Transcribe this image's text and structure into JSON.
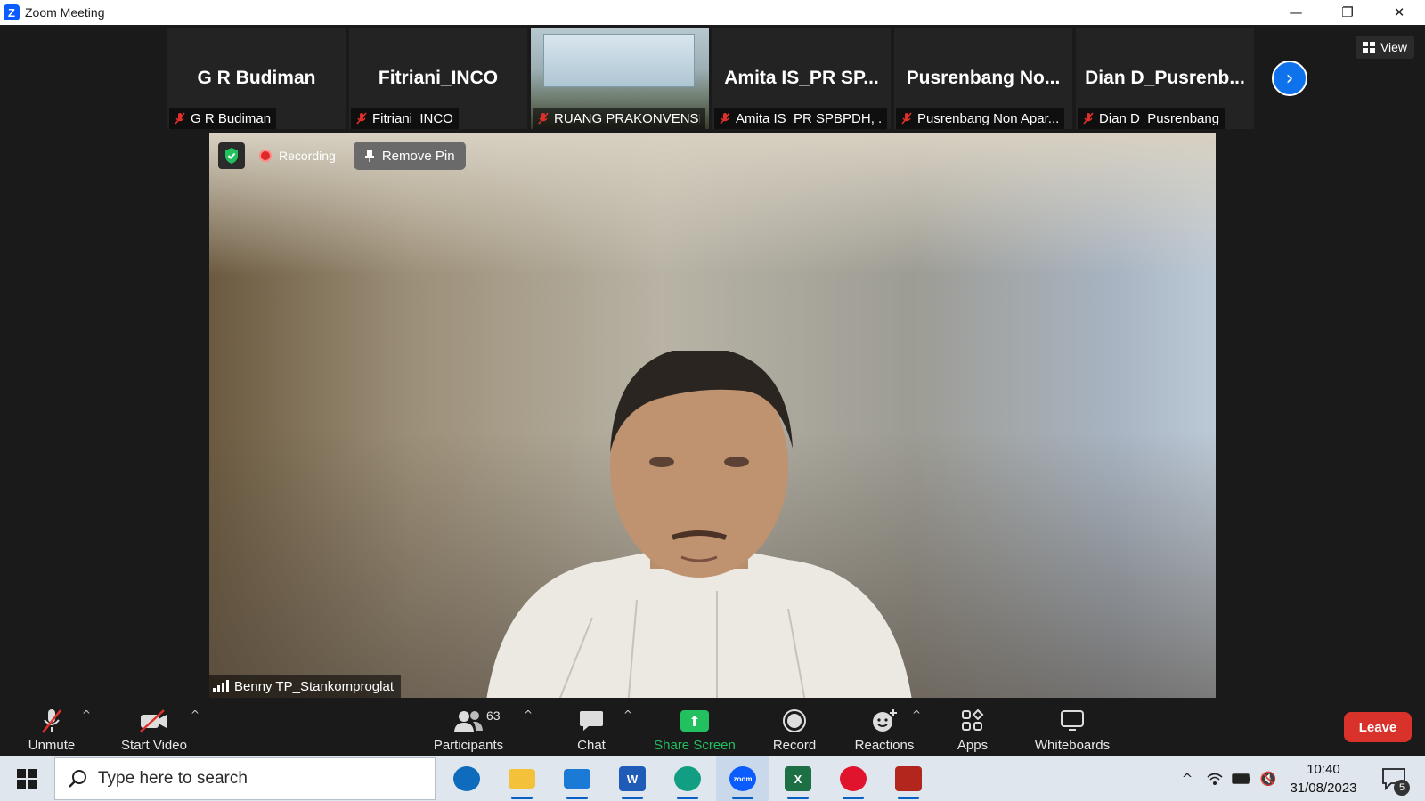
{
  "window": {
    "title": "Zoom Meeting",
    "icon": "zoom-logo-icon",
    "logo_letter": "Z",
    "controls": [
      "minimize-icon",
      "restore-icon",
      "close-icon"
    ],
    "control_glyphs": {
      "minimize": "—",
      "restore": "❐",
      "close": "✕"
    }
  },
  "gallery_strip": {
    "tiles": [
      {
        "display_name": "G R Budiman",
        "label": "G R Budiman",
        "muted": true,
        "video": false
      },
      {
        "display_name": "Fitriani_INCO",
        "label": "Fitriani_INCO",
        "muted": true,
        "video": false
      },
      {
        "display_name": "",
        "label": "RUANG PRAKONVENSI",
        "muted": true,
        "video": true
      },
      {
        "display_name": "Amita IS_PR SP...",
        "label": "Amita IS_PR SPBPDH, ...",
        "muted": true,
        "video": false
      },
      {
        "display_name": "Pusrenbang  No...",
        "label": "Pusrenbang Non Apar...",
        "muted": true,
        "video": false
      },
      {
        "display_name": "Dian  D_Pusrenb...",
        "label": "Dian D_Pusrenbang",
        "muted": true,
        "video": false
      }
    ],
    "next_icon": "chevron-right-icon",
    "next_glyph": "›"
  },
  "view_button": {
    "label": "View",
    "icon": "grid-view-icon"
  },
  "main_video": {
    "security_icon": "shield-check-icon",
    "recording_label": "Recording",
    "remove_pin_label": "Remove Pin",
    "speaker_name": "Benny TP_Stankomproglat",
    "signal_icon": "signal-bars-icon"
  },
  "toolbar": {
    "unmute_label": "Unmute",
    "start_video_label": "Start Video",
    "participants_label": "Participants",
    "participants_count": "63",
    "chat_label": "Chat",
    "share_screen_label": "Share Screen",
    "share_glyph": "⬆",
    "record_label": "Record",
    "reactions_label": "Reactions",
    "apps_label": "Apps",
    "whiteboards_label": "Whiteboards",
    "leave_label": "Leave",
    "caret_glyph": "^"
  },
  "taskbar": {
    "search_placeholder": "Type here to search",
    "apps": [
      {
        "name": "outlook-icon",
        "color": "#0f6cbd"
      },
      {
        "name": "file-explorer-icon",
        "color": "#f3c13a"
      },
      {
        "name": "mail-icon",
        "color": "#1b7ad6"
      },
      {
        "name": "word-icon",
        "color": "#1f5cb8",
        "text": "W"
      },
      {
        "name": "edge-icon",
        "color": "#129e83"
      },
      {
        "name": "zoom-icon",
        "color": "#0b5cff",
        "text": "zoom"
      },
      {
        "name": "excel-icon",
        "color": "#1d7044",
        "text": "X"
      },
      {
        "name": "opera-icon",
        "color": "#e0152d"
      },
      {
        "name": "game-icon",
        "color": "#b3261e"
      }
    ],
    "tray_icons": [
      "chevron-up-icon",
      "wifi-icon",
      "battery-icon",
      "speaker-muted-icon"
    ],
    "tray_glyphs": {
      "chevron": "^",
      "volume": "🔇"
    },
    "time": "10:40",
    "date": "31/08/2023",
    "notifications_count": "5",
    "notifications_icon": "notifications-icon"
  },
  "colors": {
    "meeting_bg": "#1a1a1a",
    "share_green": "#23c060",
    "leave_red": "#d8322a",
    "accent_blue": "#0e72ed",
    "taskbar_bg": "#dfe6ee"
  }
}
